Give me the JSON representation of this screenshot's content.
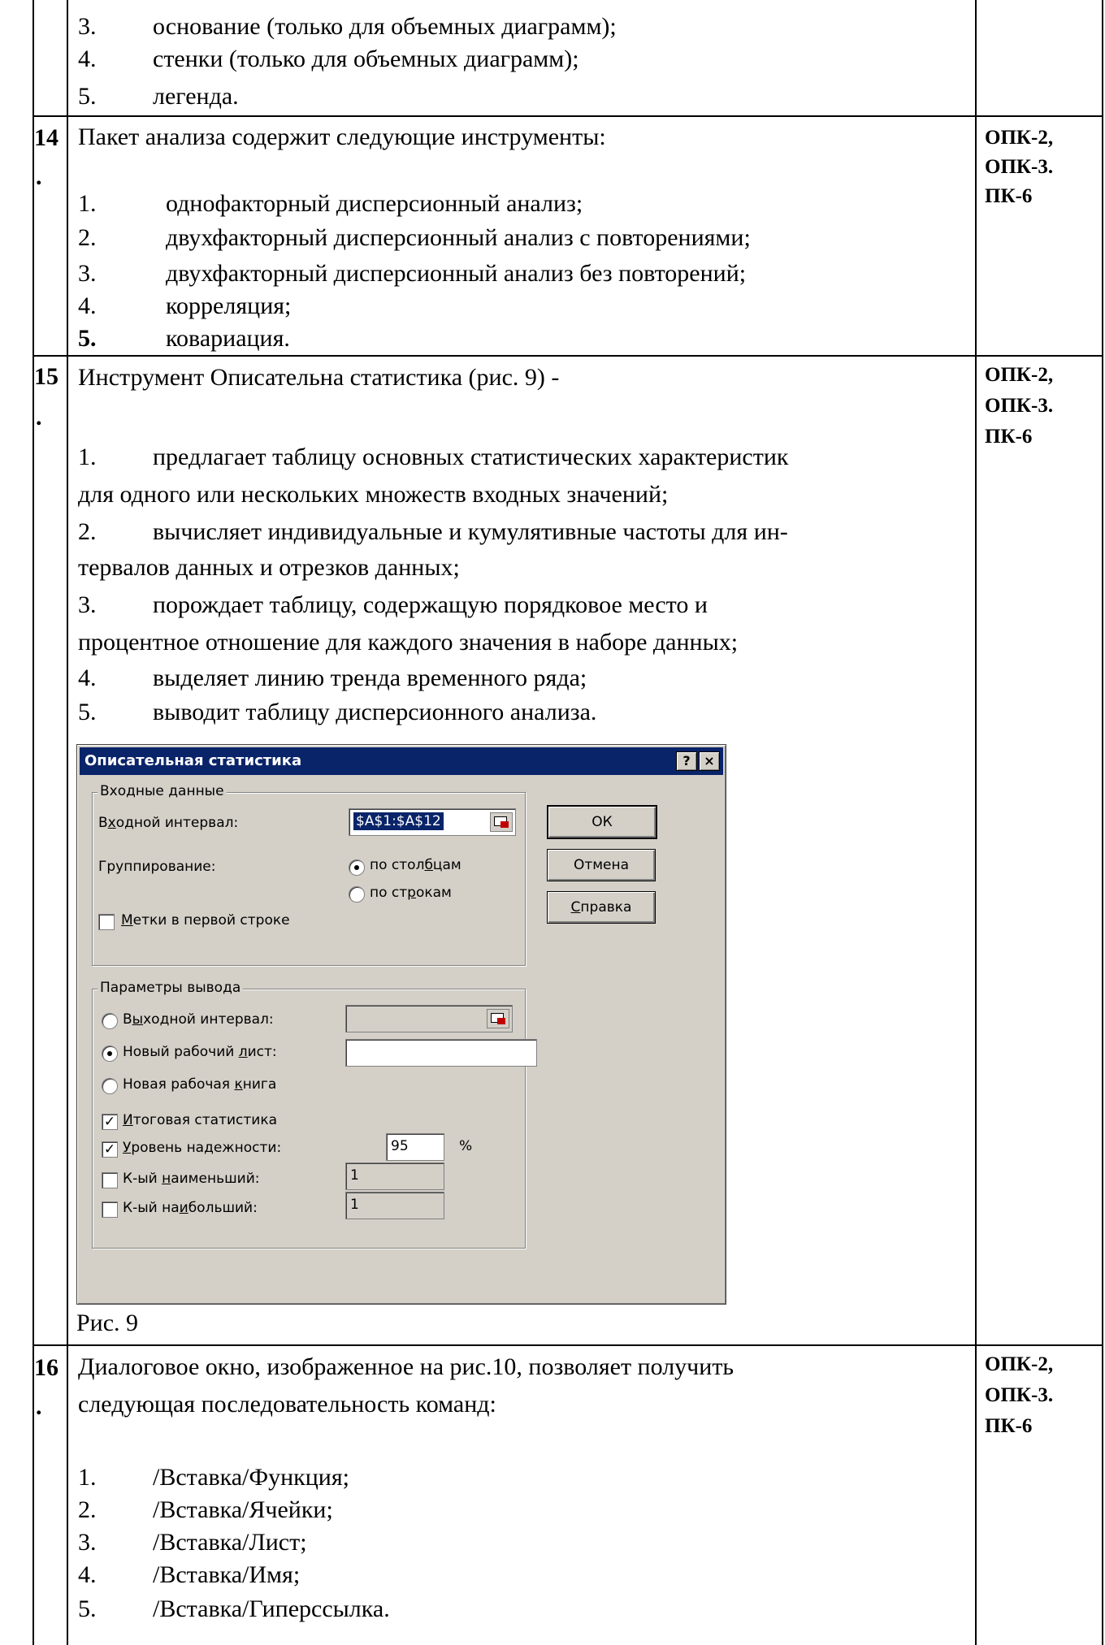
{
  "top_items": [
    {
      "n": "3.",
      "text": "основание (только для объемных диаграмм);"
    },
    {
      "n": "4.",
      "text": "стенки (только для объемных диаграмм);"
    },
    {
      "n": "5.",
      "text": "легенда."
    }
  ],
  "q14": {
    "num": "14",
    "dot": ".",
    "question": "Пакет анализа содержит следующие инструменты:",
    "codes": [
      "ОПК-2,",
      "ОПК-3.",
      "ПК-6"
    ],
    "options": [
      {
        "n": "1.",
        "text": "однофакторный дисперсионный анализ;"
      },
      {
        "n": "2.",
        "text": "двухфакторный дисперсионный анализ с повторениями;"
      },
      {
        "n": "3.",
        "text": "двухфакторный дисперсионный анализ без повторений;"
      },
      {
        "n": "4.",
        "text": "корреляция;"
      },
      {
        "n": "5.",
        "text": "ковариация."
      }
    ]
  },
  "q15": {
    "num": "15",
    "dot": ".",
    "question": "Инструмент Описательна статистика (рис. 9) -",
    "codes": [
      "ОПК-2,",
      "ОПК-3.",
      "ПК-6"
    ],
    "options": [
      {
        "n": "1.",
        "line1": "предлагает таблицу основных статистических характеристик",
        "line2": "для одного или нескольких множеств входных значений;"
      },
      {
        "n": "2.",
        "line1": "вычисляет индивидуальные и кумулятивные частоты для ин-",
        "line2": "тервалов данных и отрезков данных;"
      },
      {
        "n": "3.",
        "line1": "порождает таблицу, содержащую порядковое место и",
        "line2": "процентное отношение для каждого значения в наборе данных;"
      },
      {
        "n": "4.",
        "line1": "выделяет линию тренда временного ряда;"
      },
      {
        "n": "5.",
        "line1": "выводит таблицу дисперсионного анализа."
      }
    ],
    "caption": "Рис. 9"
  },
  "dialog": {
    "title": "Описательная статистика",
    "help_btn": "?",
    "close_btn": "×",
    "input_group": "Входные данные",
    "input_range_label_pre": "В",
    "input_range_label_u": "х",
    "input_range_label_post": "одной интервал:",
    "input_range_value": "$A$1:$A$12",
    "grouping_label": "Группирование:",
    "by_columns_pre": "по стол",
    "by_columns_u": "б",
    "by_columns_post": "цам",
    "by_rows_pre": "по ст",
    "by_rows_u": "р",
    "by_rows_post": "окам",
    "labels_first_row_u": "М",
    "labels_first_row_post": "етки в первой строке",
    "ok": "ОК",
    "cancel": "Отмена",
    "help_u": "С",
    "help_post": "правка",
    "output_group": "Параметры вывода",
    "output_range_pre": "В",
    "output_range_u": "ы",
    "output_range_post": "ходной интервал:",
    "new_sheet_pre": "Новый рабочий ",
    "new_sheet_u": "л",
    "new_sheet_post": "ист:",
    "new_book_pre": "Новая рабочая ",
    "new_book_u": "к",
    "new_book_post": "нига",
    "summary_u": "И",
    "summary_post": "тоговая статистика",
    "confidence_u": "У",
    "confidence_post": "ровень надежности:",
    "confidence_value": "95",
    "percent": "%",
    "kth_smallest_pre": "К-ый ",
    "kth_smallest_u": "н",
    "kth_smallest_post": "аименьший:",
    "kth_smallest_value": "1",
    "kth_largest_pre": "К-ый на",
    "kth_largest_u": "и",
    "kth_largest_post": "больший:",
    "kth_largest_value": "1",
    "checkmark": "✓"
  },
  "q16": {
    "num": "16",
    "dot": ".",
    "question_line1": "Диалоговое окно, изображенное на рис.10, позволяет получить",
    "question_line2": "следующая  последовательность команд:",
    "codes": [
      "ОПК-2,",
      "ОПК-3.",
      "ПК-6"
    ],
    "options": [
      {
        "n": "1.",
        "text": "/Вставка/Функция;"
      },
      {
        "n": "2.",
        "text": "/Вставка/Ячейки;"
      },
      {
        "n": "3.",
        "text": "/Вставка/Лист;"
      },
      {
        "n": "4.",
        "text": "/Вставка/Имя;"
      },
      {
        "n": "5.",
        "text": "/Вставка/Гиперссылка."
      }
    ]
  }
}
